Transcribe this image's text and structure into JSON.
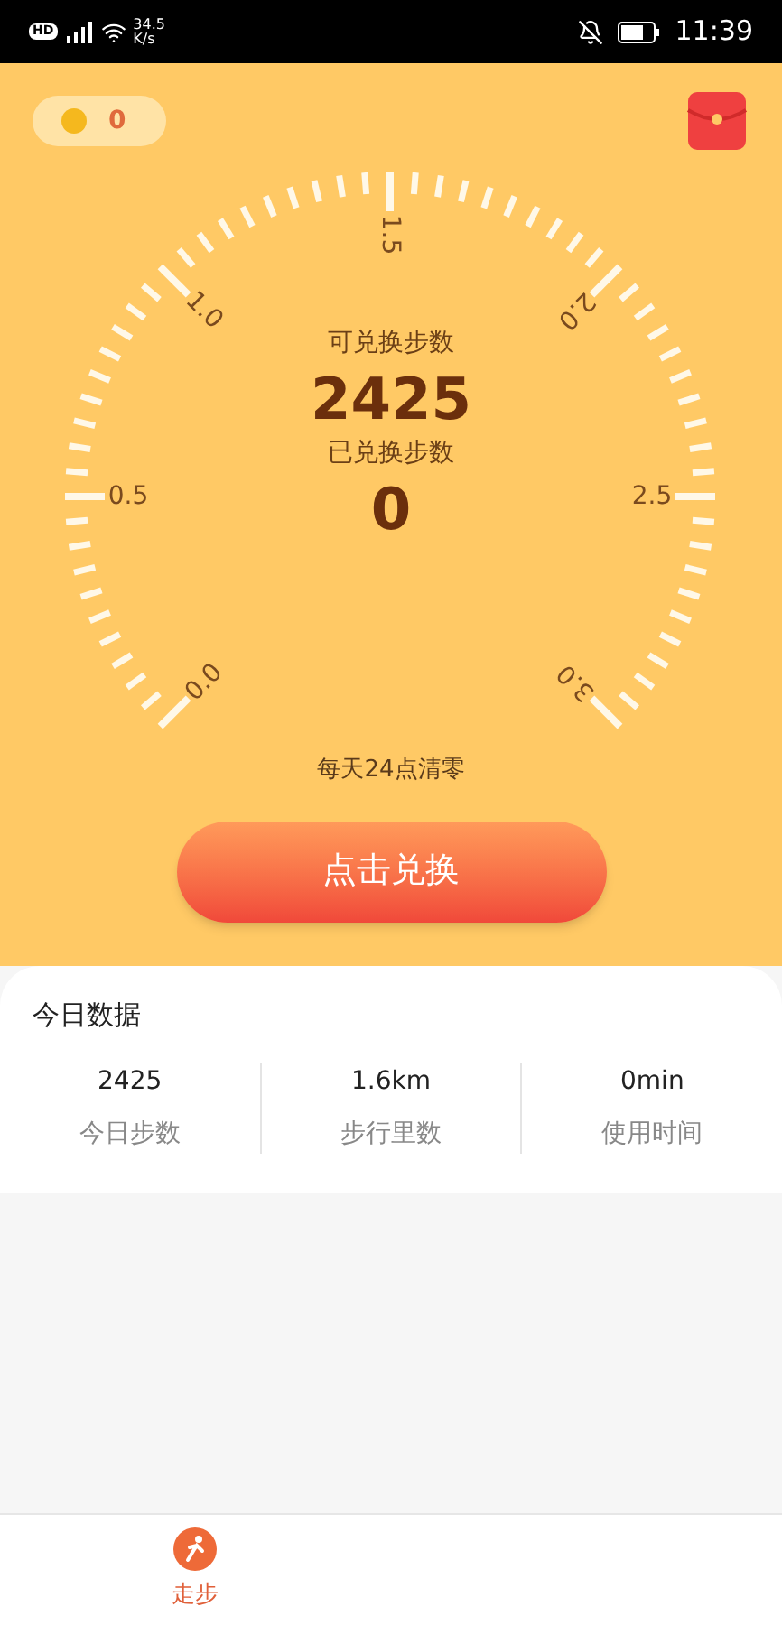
{
  "status_bar": {
    "hd_badge": "HD",
    "network_speed": "34.5",
    "network_unit": "K/s",
    "time": "11:39"
  },
  "coins": {
    "value": "0"
  },
  "gauge": {
    "scale_labels": [
      "0.0",
      "0.5",
      "1.0",
      "1.5",
      "2.0",
      "2.5",
      "3.0"
    ],
    "available_label": "可兑换步数",
    "available_value": "2425",
    "exchanged_label": "已兑换步数",
    "exchanged_value": "0"
  },
  "reset_note": "每天24点清零",
  "exchange_button": "点击兑换",
  "today": {
    "title": "今日数据",
    "stats": [
      {
        "value": "2425",
        "label": "今日步数"
      },
      {
        "value": "1.6km",
        "label": "步行里数"
      },
      {
        "value": "0min",
        "label": "使用时间"
      }
    ]
  },
  "bottom_nav": [
    {
      "label": "走步",
      "selected": true
    }
  ]
}
